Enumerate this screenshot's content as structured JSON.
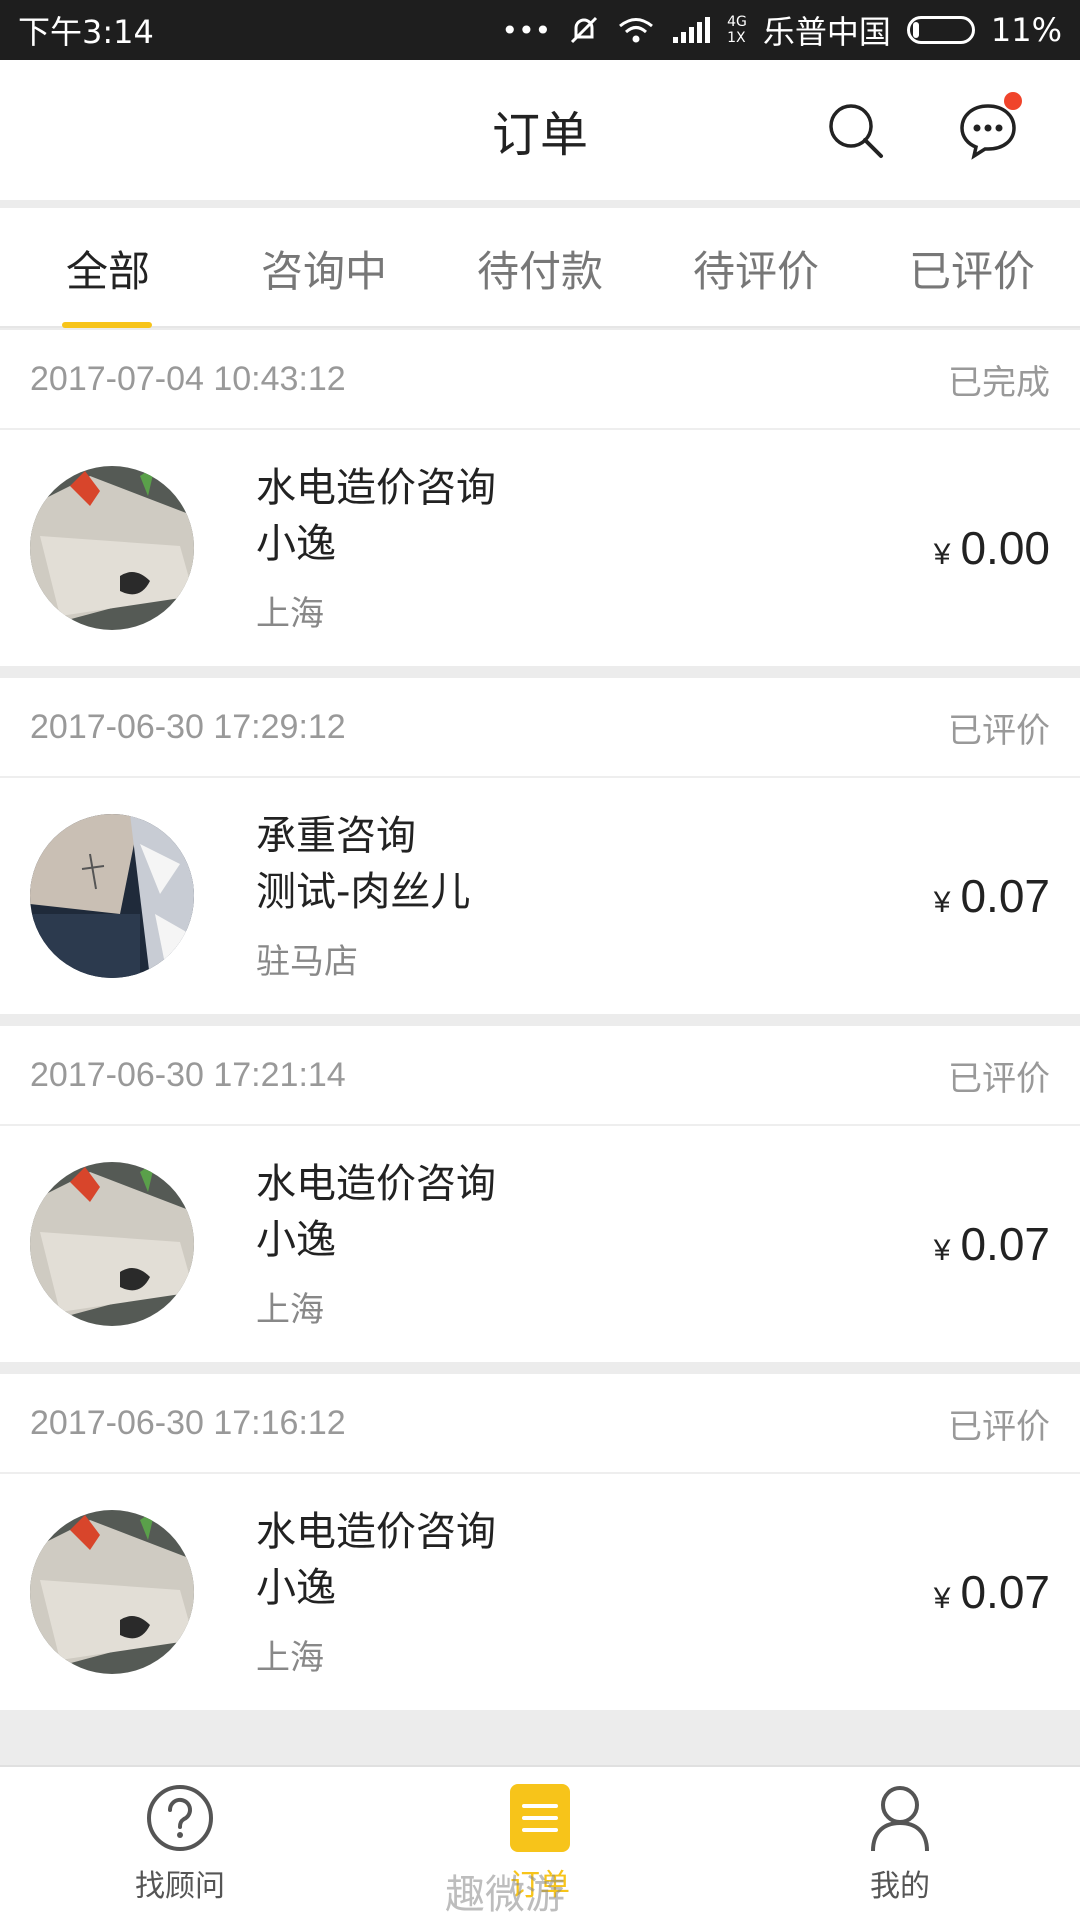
{
  "status_bar": {
    "time": "下午3:14",
    "dots": "•••",
    "net_top": "4G",
    "net_bottom": "1X",
    "carrier": "乐普中国",
    "battery": "11%"
  },
  "header": {
    "title": "订单",
    "icons": [
      "search-icon",
      "message-icon"
    ],
    "accent_color": "#f7c41a",
    "badge_color": "#f0442b"
  },
  "tabs": [
    {
      "label": "全部",
      "active": true
    },
    {
      "label": "咨询中",
      "active": false
    },
    {
      "label": "待付款",
      "active": false
    },
    {
      "label": "待评价",
      "active": false
    },
    {
      "label": "已评价",
      "active": false
    }
  ],
  "orders": [
    {
      "datetime": "2017-07-04 10:43:12",
      "status": "已完成",
      "service": "水电造价咨询",
      "person": "小逸",
      "city": "上海",
      "currency": "¥",
      "amount": "0.00",
      "avatar": "book-photo"
    },
    {
      "datetime": "2017-06-30 17:29:12",
      "status": "已评价",
      "service": "承重咨询",
      "person": "测试-肉丝儿",
      "city": "驻马店",
      "currency": "¥",
      "amount": "0.07",
      "avatar": "arm-photo"
    },
    {
      "datetime": "2017-06-30 17:21:14",
      "status": "已评价",
      "service": "水电造价咨询",
      "person": "小逸",
      "city": "上海",
      "currency": "¥",
      "amount": "0.07",
      "avatar": "book-photo"
    },
    {
      "datetime": "2017-06-30 17:16:12",
      "status": "已评价",
      "service": "水电造价咨询",
      "person": "小逸",
      "city": "上海",
      "currency": "¥",
      "amount": "0.07",
      "avatar": "book-photo"
    }
  ],
  "bottom_nav": [
    {
      "label": "找顾问",
      "icon": "question-icon",
      "active": false
    },
    {
      "label": "订单",
      "icon": "order-list-icon",
      "active": true
    },
    {
      "label": "我的",
      "icon": "user-icon",
      "active": false
    }
  ],
  "watermark": "趣微游"
}
